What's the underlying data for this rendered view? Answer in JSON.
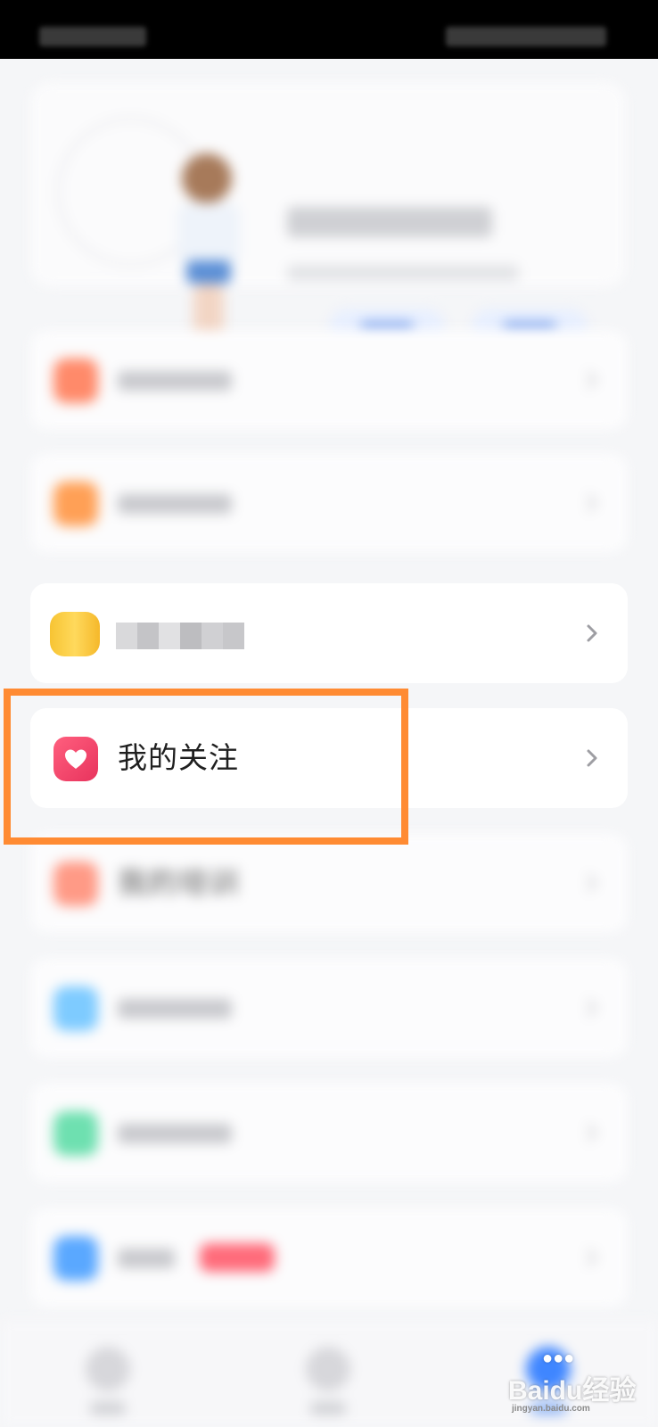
{
  "items": {
    "my_follows": {
      "label": "我的关注"
    },
    "my_training": {
      "label": "我的培训"
    }
  },
  "colors": {
    "highlight": "#ff8b33",
    "follows_icon": "#f0426a"
  },
  "watermark": {
    "text": "Baidu经验",
    "url": "jingyan.baidu.com"
  }
}
